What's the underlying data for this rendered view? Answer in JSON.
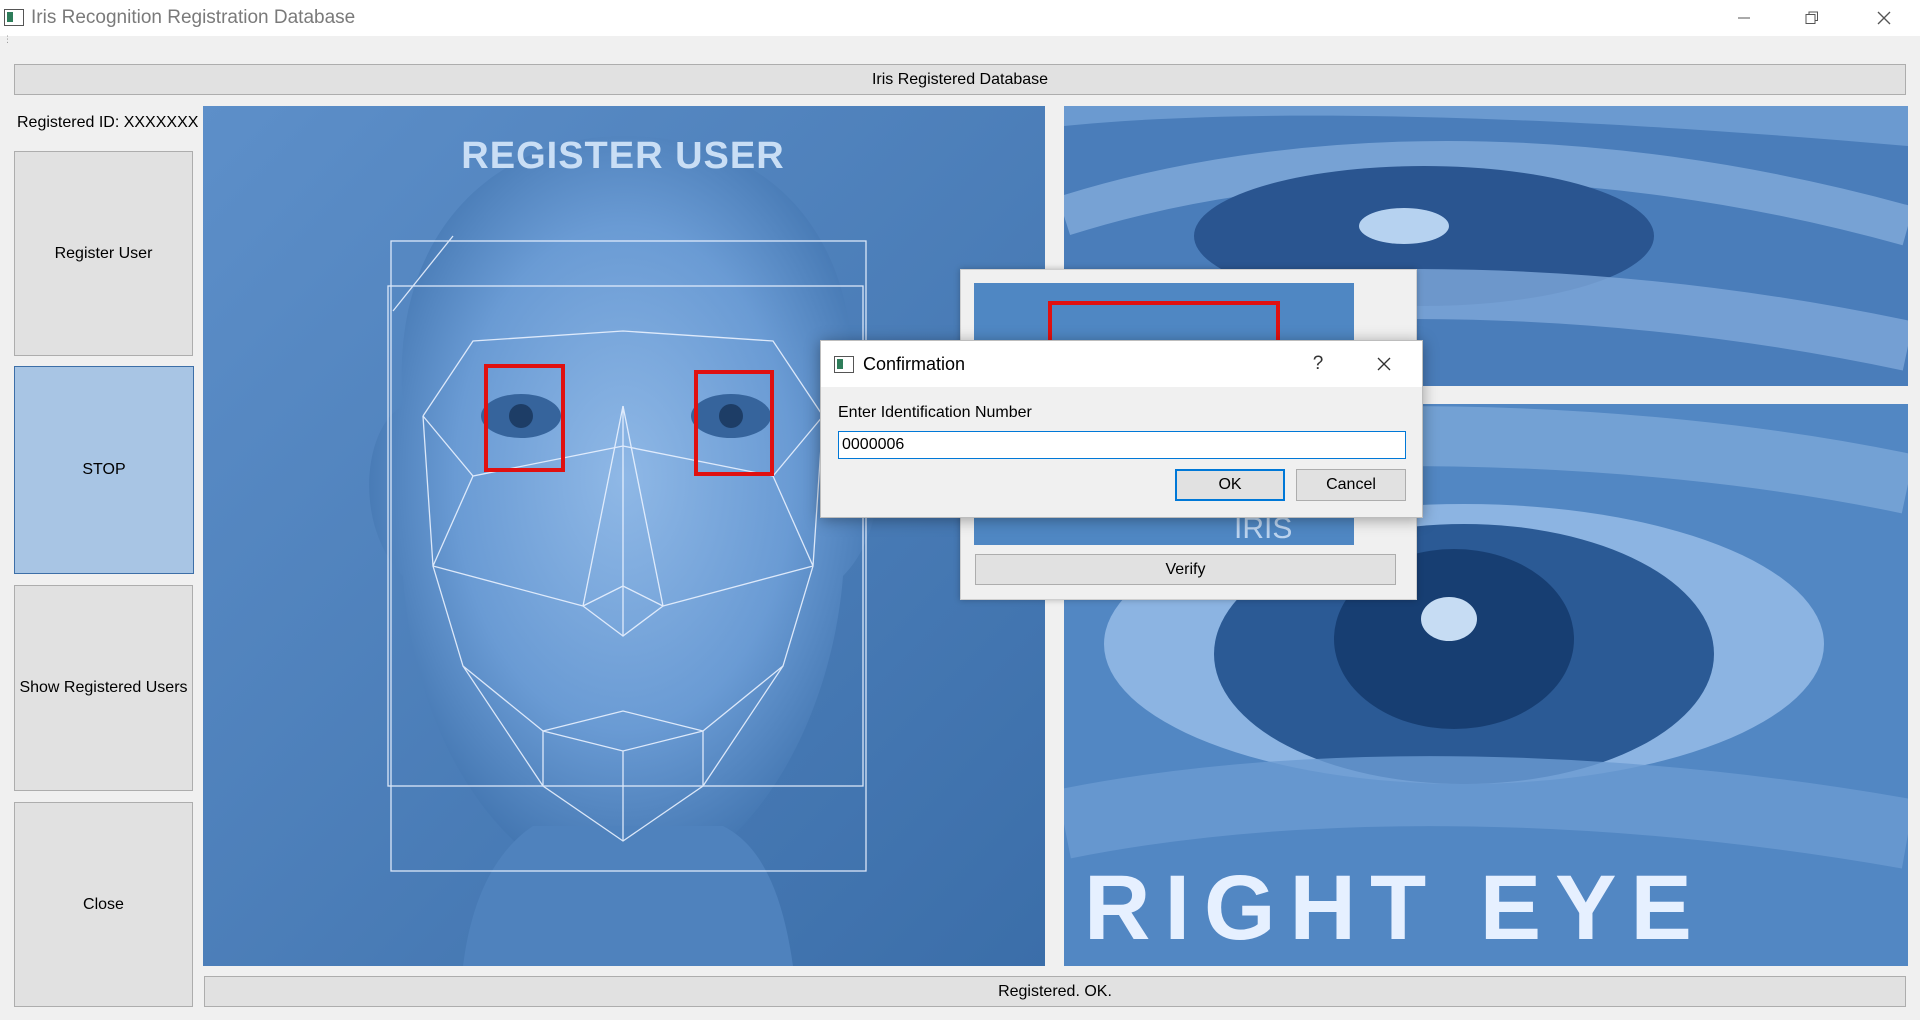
{
  "window": {
    "title": "Iris Recognition Registration Database"
  },
  "header": {
    "label": "Iris Registered Database"
  },
  "sidebar": {
    "registered_id": "Registered ID: XXXXXXX",
    "buttons": {
      "register": "Register User",
      "stop": "STOP",
      "show": "Show Registered Users",
      "close": "Close"
    }
  },
  "images": {
    "face_caption": "REGISTER USER",
    "right_eye_caption": "RIGHT  EYE",
    "verify_caption": "IRIS"
  },
  "verify_window": {
    "button": "Verify"
  },
  "dialog": {
    "title": "Confirmation",
    "help": "?",
    "prompt": "Enter Identification Number",
    "input_value": "0000006",
    "ok": "OK",
    "cancel": "Cancel"
  },
  "status": {
    "message": "Registered. OK."
  },
  "colors": {
    "stop_active": "#a8c5e4",
    "focus_blue": "#0078d7",
    "image_blue": "#4a7fba",
    "detection_red": "#e01010"
  }
}
